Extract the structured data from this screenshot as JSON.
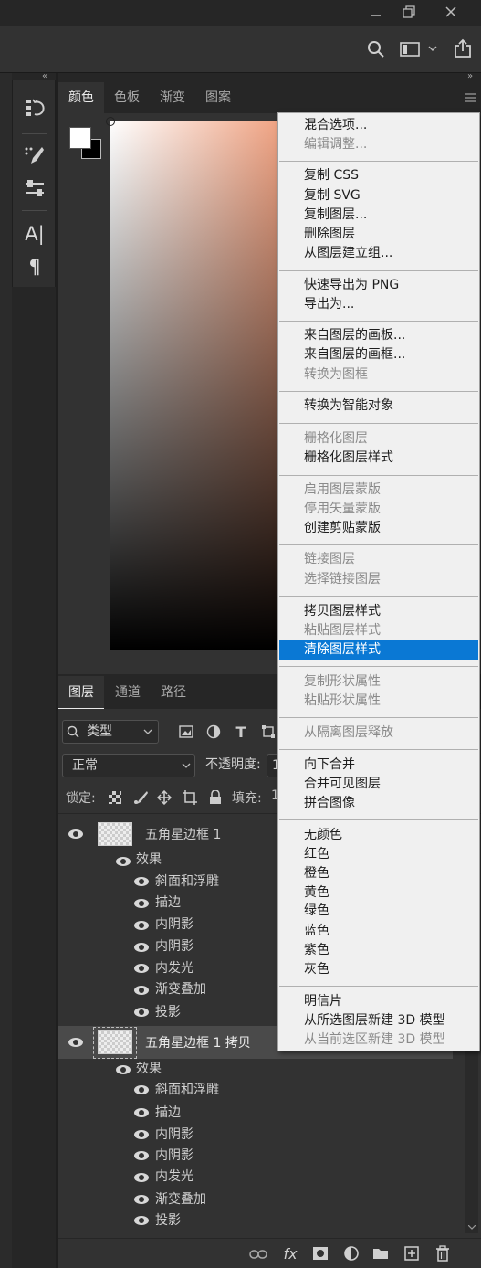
{
  "window": {
    "minimize_icon": "minimize-icon",
    "restore_icon": "restore-icon",
    "close_icon": "close-icon"
  },
  "color_panel": {
    "tabs": [
      "颜色",
      "色板",
      "渐变",
      "图案"
    ],
    "spectrum_colors": {
      "top_right": "#f0a383",
      "top_left": "#ffffff",
      "bottom": "#000000"
    }
  },
  "layers_panel": {
    "tabs": [
      "图层",
      "通道",
      "路径"
    ],
    "filter_label": "类型",
    "blend_mode": "正常",
    "opacity_label": "不透明度:",
    "opacity_value": "1",
    "lock_label": "锁定:",
    "fill_label": "填充:",
    "fill_value": "1",
    "layers": [
      {
        "name": "五角星边框 1",
        "effects_label": "效果",
        "effects": [
          "斜面和浮雕",
          "描边",
          "内阴影",
          "内阴影",
          "内发光",
          "渐变叠加",
          "投影"
        ]
      },
      {
        "name": "五角星边框 1 拷贝",
        "effects_label": "效果",
        "effects": [
          "斜面和浮雕",
          "描边",
          "内阴影",
          "内阴影",
          "内发光",
          "渐变叠加",
          "投影"
        ]
      }
    ],
    "bottom_fx": "fx"
  },
  "menu": {
    "items": [
      {
        "label": "混合选项..."
      },
      {
        "label": "编辑调整..."
      },
      {
        "label": "复制 CSS"
      },
      {
        "label": "复制 SVG"
      },
      {
        "label": "复制图层..."
      },
      {
        "label": "删除图层"
      },
      {
        "label": "从图层建立组..."
      },
      {
        "label": "快速导出为 PNG"
      },
      {
        "label": "导出为..."
      },
      {
        "label": "来自图层的画板..."
      },
      {
        "label": "来自图层的画框..."
      },
      {
        "label": "转换为图框"
      },
      {
        "label": "转换为智能对象"
      },
      {
        "label": "栅格化图层"
      },
      {
        "label": "栅格化图层样式"
      },
      {
        "label": "启用图层蒙版"
      },
      {
        "label": "停用矢量蒙版"
      },
      {
        "label": "创建剪贴蒙版"
      },
      {
        "label": "链接图层"
      },
      {
        "label": "选择链接图层"
      },
      {
        "label": "拷贝图层样式"
      },
      {
        "label": "粘贴图层样式"
      },
      {
        "label": "清除图层样式"
      },
      {
        "label": "复制形状属性"
      },
      {
        "label": "粘贴形状属性"
      },
      {
        "label": "从隔离图层释放"
      },
      {
        "label": "向下合并"
      },
      {
        "label": "合并可见图层"
      },
      {
        "label": "拼合图像"
      },
      {
        "label": "无颜色"
      },
      {
        "label": "红色"
      },
      {
        "label": "橙色"
      },
      {
        "label": "黄色"
      },
      {
        "label": "绿色"
      },
      {
        "label": "蓝色"
      },
      {
        "label": "紫色"
      },
      {
        "label": "灰色"
      },
      {
        "label": "明信片"
      },
      {
        "label": "从所选图层新建 3D 模型"
      },
      {
        "label": "从当前选区新建 3D 模型"
      }
    ],
    "highlight_color": "#0a78d4"
  }
}
